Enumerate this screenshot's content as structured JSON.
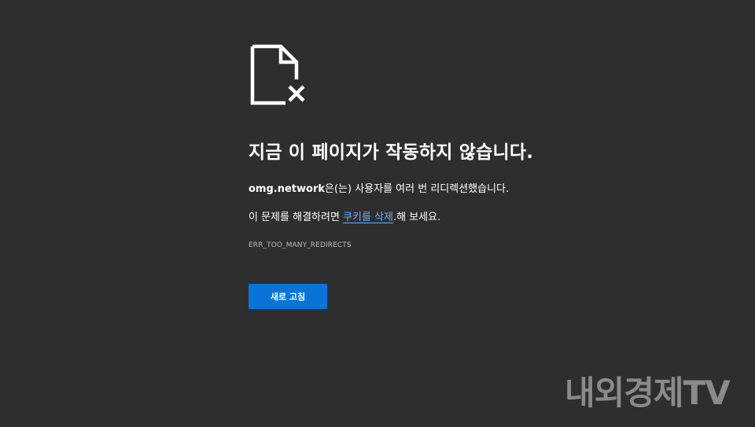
{
  "error_page": {
    "title": "지금 이 페이지가 작동하지 않습니다.",
    "description_host": "omg.network",
    "description_rest": "은(는) 사용자를 여러 번 리디렉션했습니다.",
    "hint_prefix": "이 문제를 해결하려면 ",
    "hint_link": "쿠키를 삭제",
    "hint_suffix": ".해 보세요.",
    "error_code": "ERR_TOO_MANY_REDIRECTS",
    "reload_label": "새로 고침",
    "icon": "broken-file-icon"
  },
  "watermark": {
    "text": "내외경제TV"
  },
  "colors": {
    "background": "#2e2e2e",
    "button": "#0a74d6",
    "link": "#6cb0f2",
    "watermark": "#8a8a8a"
  }
}
